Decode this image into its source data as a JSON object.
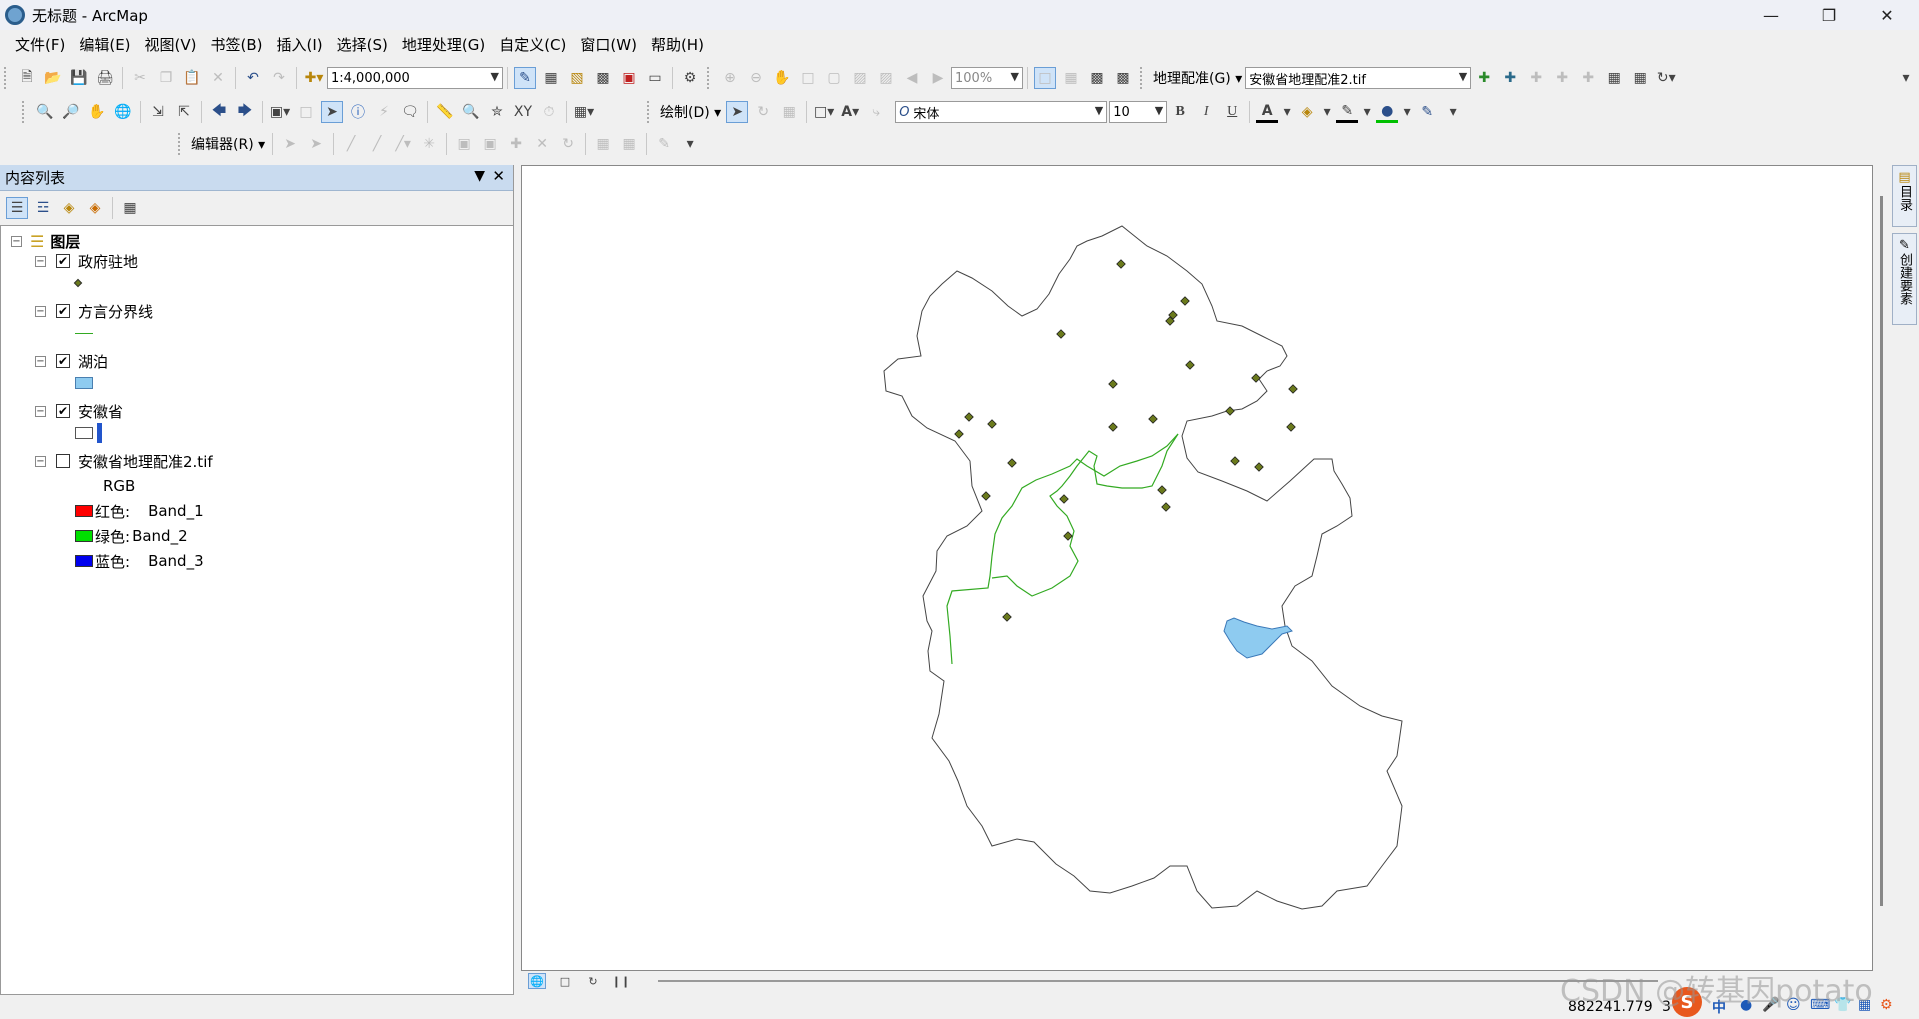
{
  "window": {
    "title": "无标题 - ArcMap"
  },
  "menus": [
    "文件(F)",
    "编辑(E)",
    "视图(V)",
    "书签(B)",
    "插入(I)",
    "选择(S)",
    "地理处理(G)",
    "自定义(C)",
    "窗口(W)",
    "帮助(H)"
  ],
  "toolbar": {
    "scale": "1:4,000,000",
    "zoom_percent": "100%",
    "georef_label": "地理配准(G) ▾",
    "georef_layer": "安徽省地理配准2.tif",
    "draw_label": "绘制(D) ▾",
    "font_name": "宋体",
    "font_size": "10",
    "bold": "B",
    "italic": "I",
    "underline": "U",
    "editor_label": "编辑器(R) ▾"
  },
  "toc": {
    "title": "内容列表",
    "root": "图层",
    "layers": [
      {
        "name": "政府驻地",
        "checked": true
      },
      {
        "name": "方言分界线",
        "checked": true
      },
      {
        "name": "湖泊",
        "checked": true
      },
      {
        "name": "安徽省",
        "checked": true
      },
      {
        "name": "安徽省地理配准2.tif",
        "checked": false
      }
    ],
    "raster_type": "RGB",
    "bands": [
      {
        "label": "红色:",
        "band": "Band_1",
        "color": "#ff0000"
      },
      {
        "label": "绿色:",
        "band": "Band_2",
        "color": "#00e000"
      },
      {
        "label": "蓝色:",
        "band": "Band_3",
        "color": "#0000ee"
      }
    ]
  },
  "right_dock": [
    "目录",
    "创建要素"
  ],
  "status": {
    "coords": "882241.779",
    "coords_suffix": "3"
  },
  "watermark": "CSDN @转基因potato",
  "ime_icon": "S",
  "ime_label": "中",
  "colors": {
    "accent": "#c9dbef",
    "lake": "#8ecbf0",
    "dialect_line": "#33aa22",
    "seat": "#6b7a1c"
  }
}
